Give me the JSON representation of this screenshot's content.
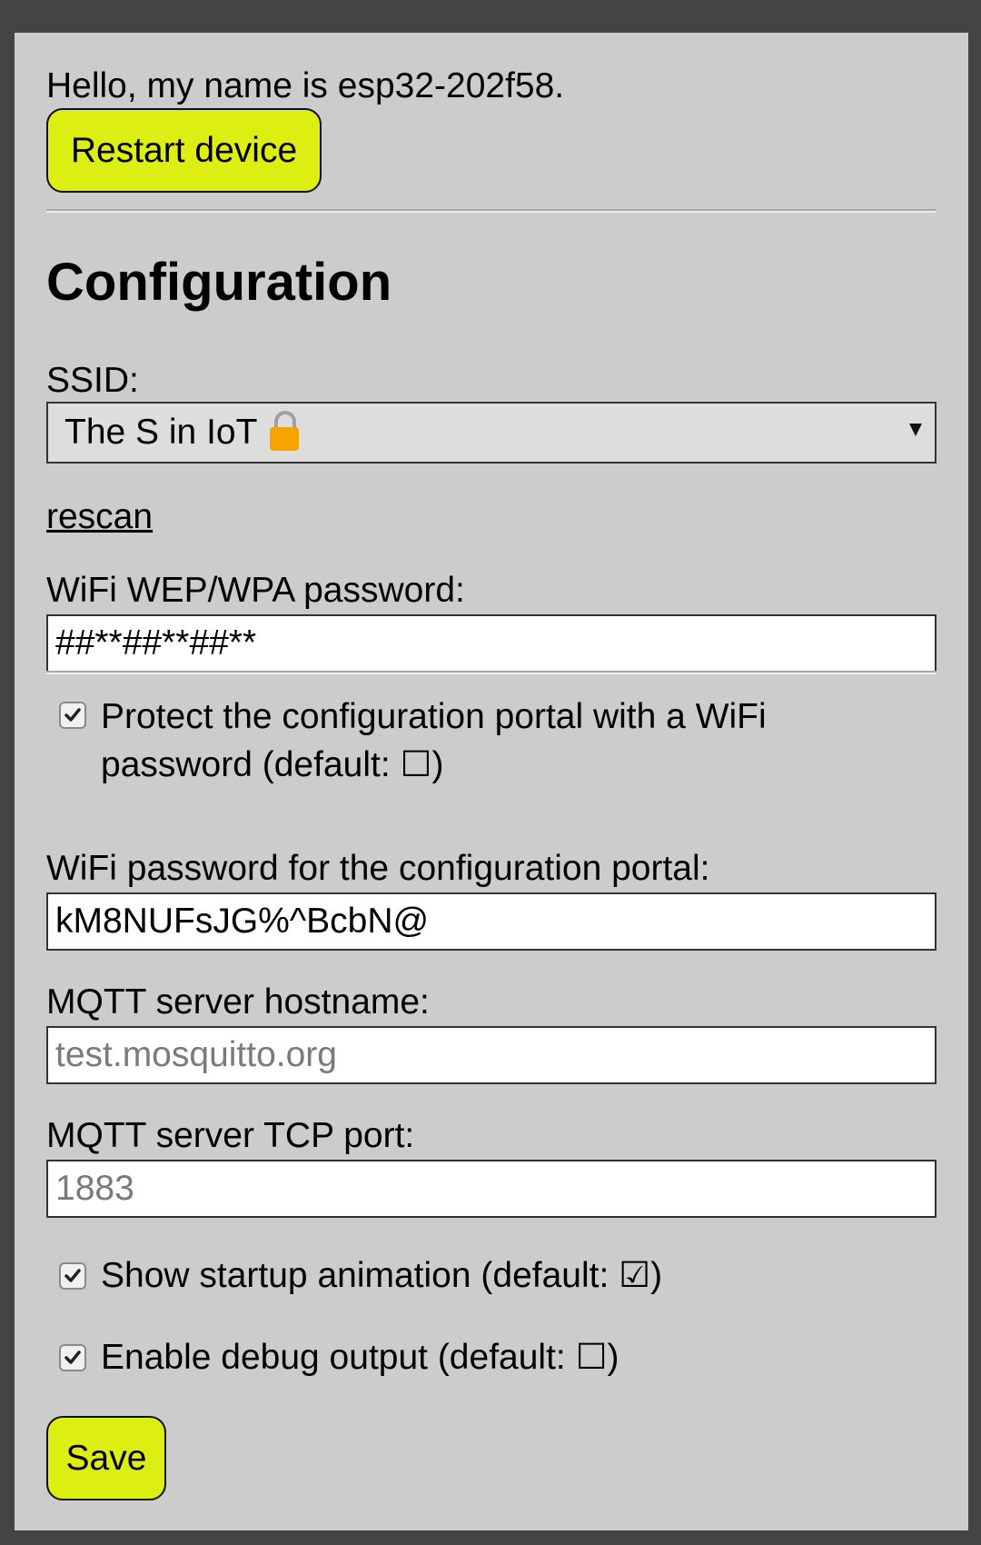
{
  "header": {
    "greeting": "Hello, my name is esp32-202f58.",
    "restart_label": "Restart device"
  },
  "config": {
    "heading": "Configuration",
    "ssid": {
      "label": "SSID:",
      "selected": "The S in IoT",
      "icon": "lock-icon",
      "rescan_label": "rescan"
    },
    "wifi_password": {
      "label": "WiFi WEP/WPA password:",
      "value": "##**##**##**"
    },
    "protect_portal": {
      "checked": true,
      "label": "Protect the configuration portal with a WiFi password (default: ☐)"
    },
    "portal_password": {
      "label": "WiFi password for the configuration portal:",
      "value": "kM8NUFsJG%^BcbN@"
    },
    "mqtt_host": {
      "label": "MQTT server hostname:",
      "placeholder": "test.mosquitto.org"
    },
    "mqtt_port": {
      "label": "MQTT server TCP port:",
      "placeholder": "1883"
    },
    "startup_animation": {
      "checked": true,
      "label": "Show startup animation (default: ☑)"
    },
    "debug_output": {
      "checked": true,
      "label": "Enable debug output (default: ☐)"
    },
    "save_label": "Save"
  },
  "colors": {
    "outer_background": "#444444",
    "panel_background": "#cccccc",
    "button_accent": "#dcee12",
    "lock_color": "#f7a400"
  }
}
